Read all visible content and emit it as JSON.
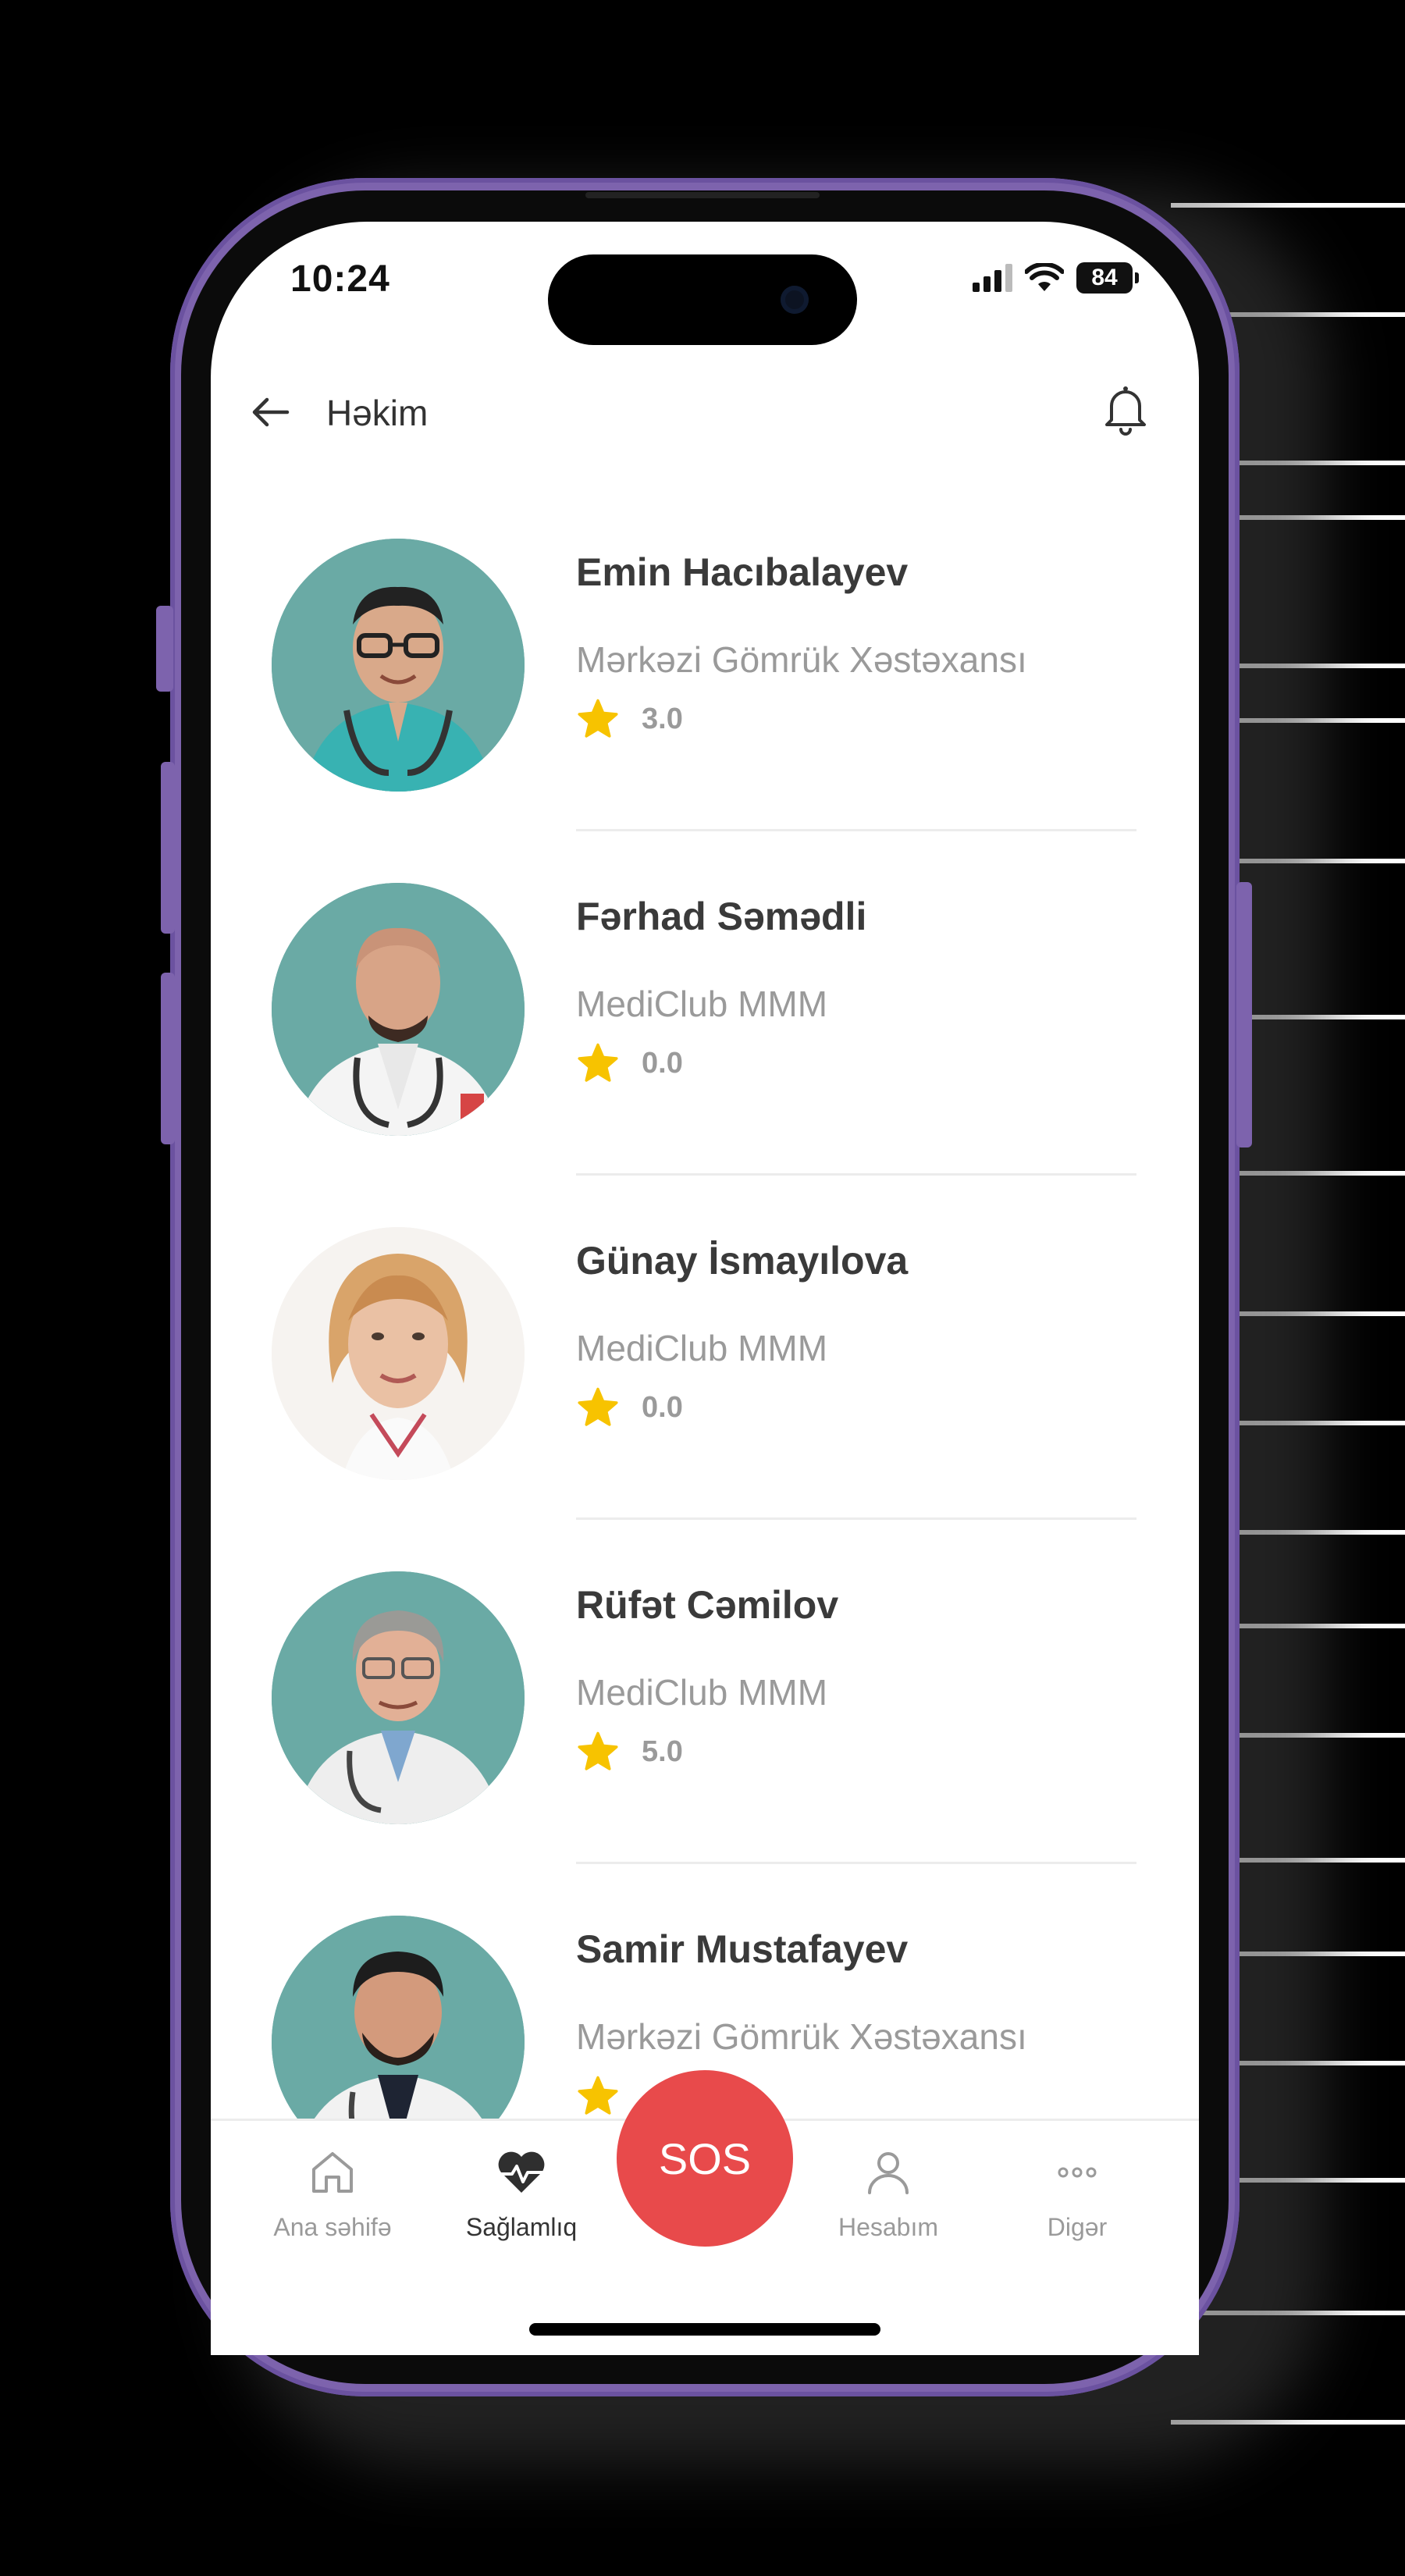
{
  "status_bar": {
    "time": "10:24",
    "battery": "84"
  },
  "header": {
    "title": "Həkim",
    "back_icon": "arrow-left-icon",
    "bell_icon": "bell-icon"
  },
  "doctors": [
    {
      "name": "Emin Hacıbalayev",
      "clinic": "Mərkəzi Gömrük Xəstəxansı",
      "rating": "3.0"
    },
    {
      "name": "Fərhad Səmədli",
      "clinic": "MediClub MMM",
      "rating": "0.0"
    },
    {
      "name": "Günay İsmayılova",
      "clinic": "MediClub MMM",
      "rating": "0.0"
    },
    {
      "name": "Rüfət Cəmilov",
      "clinic": "MediClub MMM",
      "rating": "5.0"
    },
    {
      "name": "Samir Mustafayev",
      "clinic": "Mərkəzi Gömrük Xəstəxansı",
      "rating": ""
    }
  ],
  "bottom_nav": {
    "items": [
      {
        "label": "Ana səhifə",
        "icon": "home-icon",
        "active": false
      },
      {
        "label": "Sağlamlıq",
        "icon": "heart-pulse-icon",
        "active": true
      },
      {
        "label": "Hesabım",
        "icon": "user-icon",
        "active": false
      },
      {
        "label": "Digər",
        "icon": "more-icon",
        "active": false
      }
    ],
    "sos_label": "SOS"
  },
  "colors": {
    "frame": "#7d63ad",
    "sos": "#e84a4b",
    "star": "#f7c300",
    "avatar_bg": "#6aaaa5"
  }
}
